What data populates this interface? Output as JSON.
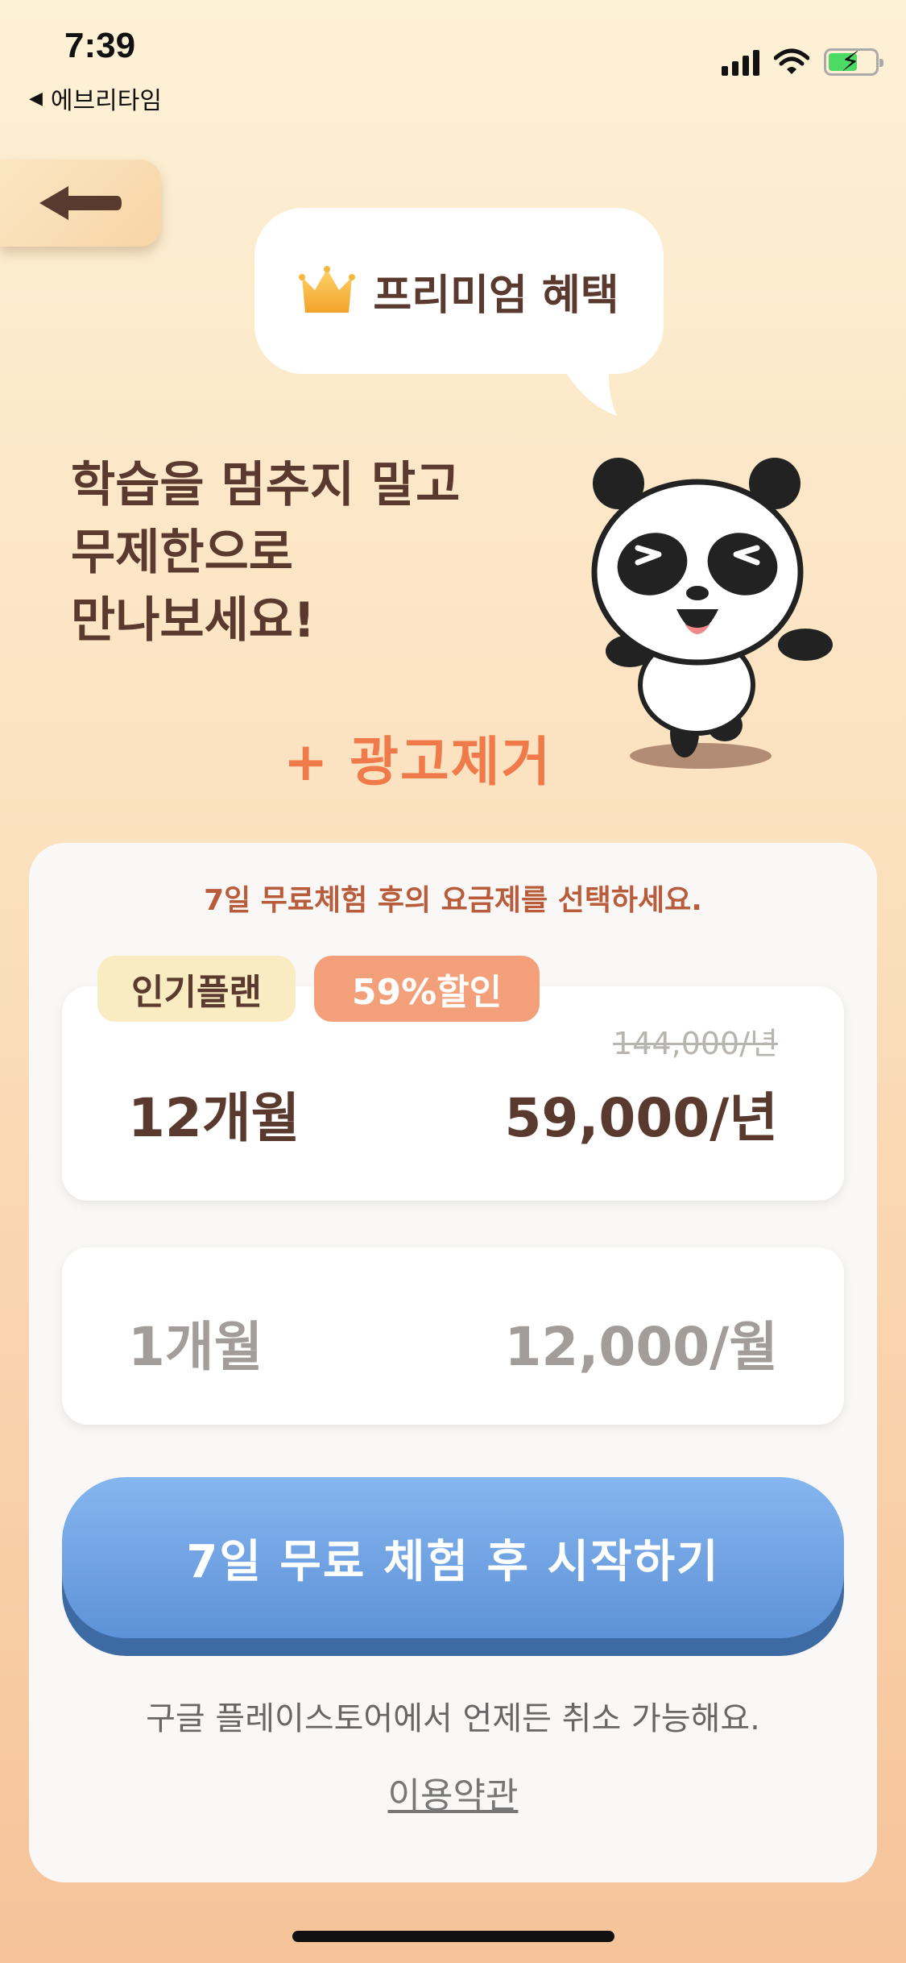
{
  "status_bar": {
    "time": "7:39",
    "back_app": "에브리타임",
    "icons": [
      "signal-icon",
      "wifi-icon",
      "battery-charging-icon"
    ]
  },
  "nav": {
    "back_icon": "arrow-left-icon"
  },
  "hero": {
    "bubble_title": "프리미엄 혜택",
    "bubble_icon": "crown-icon",
    "headline_lines": [
      "학습을 멈추지 말고",
      "무제한으로",
      "만나보세요!"
    ],
    "extra_benefit": "+ 광고제거",
    "mascot": "panda-mascot-icon"
  },
  "plans_card": {
    "notice": "7일 무료체험 후의 요금제를 선택하세요.",
    "plans": [
      {
        "name": "12개월",
        "price": "59,000/년",
        "original_price": "144,000/년",
        "badges": [
          "인기플랜",
          "59%할인"
        ],
        "selected": true
      },
      {
        "name": "1개월",
        "price": "12,000/월",
        "selected": false
      }
    ],
    "cta_label": "7일 무료 체험 후 시작하기",
    "cancel_note": "구글 플레이스토어에서 언제든 취소 가능해요.",
    "terms_link": "이용약관"
  },
  "colors": {
    "accent_orange": "#f07a4a",
    "cta_blue": "#6a9fe0",
    "text_brown": "#5a3a2e",
    "discount_badge": "#f3a07a",
    "popular_badge": "#faecc2"
  }
}
